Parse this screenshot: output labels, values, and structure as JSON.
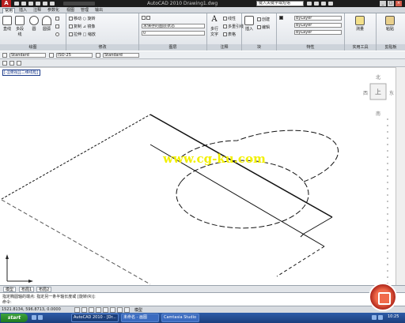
{
  "titlebar": {
    "app_button": "A",
    "title": "AutoCAD 2010   Drawing1.dwg",
    "search_value": "键入关键字或短语",
    "min": "_",
    "max": "□",
    "close": "×"
  },
  "ribbon_tabs": [
    "常用",
    "插入",
    "注释",
    "参数化",
    "视图",
    "管理",
    "输出"
  ],
  "ribbon": {
    "draw": {
      "title": "绘图",
      "tools": [
        "直线",
        "多段线",
        "圆",
        "圆弧"
      ]
    },
    "modify": {
      "title": "修改",
      "rows": [
        "移动 ○ 旋转",
        "复制 ⊿ 镜像",
        "拉伸 □ 缩放"
      ]
    },
    "layers": {
      "title": "图层",
      "rows": [
        "未保存的图层状态",
        "0"
      ]
    },
    "annotation": {
      "title": "注释",
      "tools": [
        "多行文字",
        "标注"
      ],
      "rows": [
        "线性",
        "多重引线",
        "表格"
      ]
    },
    "block": {
      "title": "块",
      "tools": [
        "插入"
      ],
      "rows": [
        "创建",
        "编辑"
      ]
    },
    "properties": {
      "title": "特性",
      "rows": [
        "ByLayer",
        "ByLayer",
        "ByLayer"
      ]
    },
    "utilities": {
      "title": "实用工具",
      "tools": [
        "测量"
      ]
    },
    "clipboard": {
      "title": "剪贴板",
      "tools": [
        "粘贴"
      ]
    }
  },
  "toolbar2": {
    "dropdowns": [
      "Standard",
      "ISO-25",
      "Standard"
    ]
  },
  "viewport": {
    "view_label": "[-][俯视][二维线框]",
    "viewcube": {
      "top_label": "上",
      "north": "北",
      "south": "南",
      "west": "西",
      "east": "东"
    },
    "watermark": "www.cg-ku.com"
  },
  "layout_tabs": [
    "模型",
    "布局1",
    "布局2"
  ],
  "command": {
    "line1": "指定椭圆轴的端点:  指定另一条半轴长度或 [旋转(R)]:",
    "line2": "命令:"
  },
  "status": {
    "coords": "1521.8134, 596.8713, 0.0000",
    "model_label": "模型"
  },
  "taskbar": {
    "start": "start",
    "items": [
      "AutoCAD 2010 - [Dr...",
      "未命名 - 画图",
      "Camtasia Studio"
    ],
    "clock": "10:25"
  },
  "colors": {
    "accent": "#b81e1e",
    "watermark": "#f2f000"
  }
}
